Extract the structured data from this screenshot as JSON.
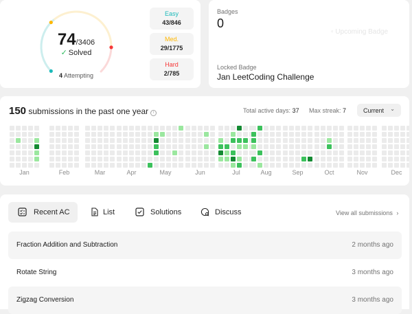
{
  "progress": {
    "solved": "74",
    "total": "/3406",
    "solved_label": "Solved",
    "attempting_count": "4",
    "attempting_label": "Attempting",
    "difficulties": [
      {
        "name": "Easy",
        "value": "43/846",
        "color": "#1cbaba"
      },
      {
        "name": "Med.",
        "value": "29/1775",
        "color": "#ffb700"
      },
      {
        "name": "Hard",
        "value": "2/785",
        "color": "#f63737"
      }
    ]
  },
  "badges": {
    "title": "Badges",
    "count": "0",
    "image_alt": "Upcoming Badge",
    "locked_label": "Locked Badge",
    "locked_name": "Jan LeetCoding Challenge"
  },
  "submissions": {
    "count": "150",
    "summary_text": "submissions in the past one year",
    "active_days_label": "Total active days:",
    "active_days": "37",
    "max_streak_label": "Max streak:",
    "max_streak": "7",
    "year_select": "Current",
    "months": [
      "Jan",
      "Feb",
      "Mar",
      "Apr",
      "May",
      "Jun",
      "Jul",
      "Aug",
      "Sep",
      "Oct",
      "Nov",
      "Dec"
    ],
    "colors": {
      "empty": "#ebebeb",
      "level1": "#9be79f",
      "level2": "#3cc15c",
      "level3": "#148a32"
    }
  },
  "tabs": [
    {
      "label": "Recent AC",
      "icon": "recent-ac-icon",
      "active": true
    },
    {
      "label": "List",
      "icon": "list-icon",
      "active": false
    },
    {
      "label": "Solutions",
      "icon": "solutions-icon",
      "active": false
    },
    {
      "label": "Discuss",
      "icon": "discuss-icon",
      "active": false
    }
  ],
  "view_all": "View all submissions",
  "recent": [
    {
      "title": "Fraction Addition and Subtraction",
      "time": "2 months ago"
    },
    {
      "title": "Rotate String",
      "time": "3 months ago"
    },
    {
      "title": "Zigzag Conversion",
      "time": "3 months ago"
    }
  ]
}
